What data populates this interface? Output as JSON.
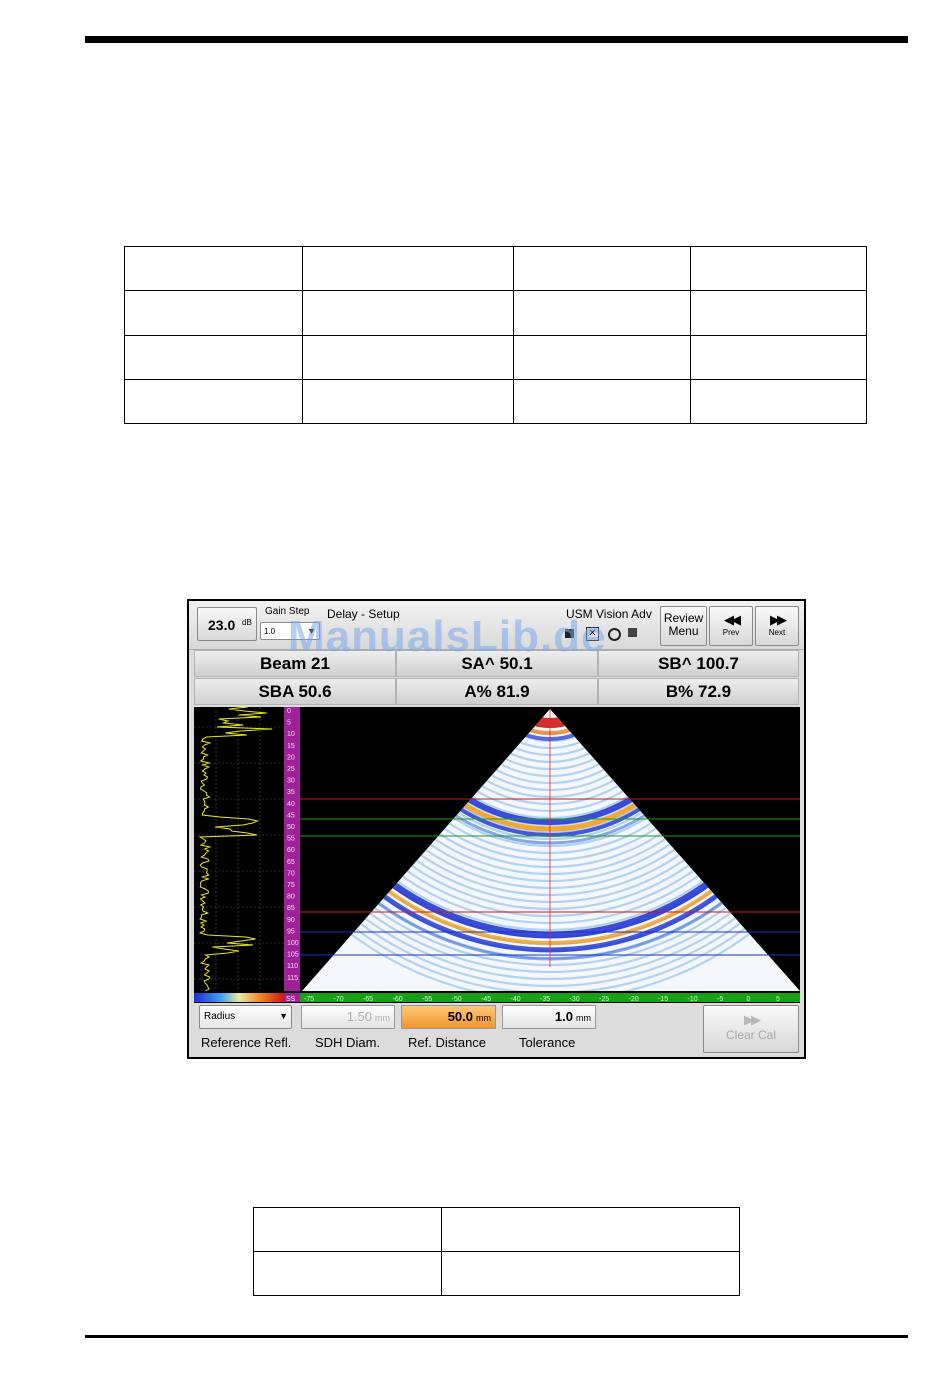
{
  "top_table": {
    "rows": 4,
    "cols": 4
  },
  "bottom_table": {
    "rows": 2,
    "cols": 2
  },
  "device": {
    "gain_value": "23.0",
    "gain_unit": "dB",
    "gain_step_label": "Gain Step",
    "gain_step_value": "1.0",
    "menu_title": "Delay - Setup",
    "app_title": "USM Vision Adv",
    "review_menu_line1": "Review",
    "review_menu_line2": "Menu",
    "prev_label": "Prev",
    "next_label": "Next",
    "readouts": {
      "beam": "Beam 21",
      "sa": "SA^ 50.1",
      "sb": "SB^ 100.7",
      "sba": "SBA 50.6",
      "a_pct": "A% 81.9",
      "b_pct": "B% 72.9"
    },
    "depth_scale": [
      "0",
      "5",
      "10",
      "15",
      "20",
      "25",
      "30",
      "35",
      "40",
      "45",
      "50",
      "55",
      "60",
      "65",
      "70",
      "75",
      "80",
      "85",
      "90",
      "95",
      "100",
      "105",
      "110",
      "115"
    ],
    "depth_scale_end": "SS",
    "angle_scale": [
      "-75",
      "-70",
      "-65",
      "-60",
      "-55",
      "-50",
      "-45",
      "-40",
      "-35",
      "-30",
      "-25",
      "-20",
      "-15",
      "-10",
      "-5",
      "0",
      "5"
    ],
    "reference_refl_value": "Radius",
    "reference_refl_label": "Reference Refl.",
    "sdh_diam_value": "1.50",
    "sdh_diam_unit": "mm",
    "sdh_diam_label": "SDH Diam.",
    "ref_distance_value": "50.0",
    "ref_distance_unit": "mm",
    "ref_distance_label": "Ref. Distance",
    "tolerance_value": "1.0",
    "tolerance_unit": "mm",
    "tolerance_label": "Tolerance",
    "clear_cal_label": "Clear Cal"
  },
  "watermark": "ManualsLib.de",
  "colors": {
    "gate_red": "#d01818",
    "gate_green": "#1aa01a",
    "gate_blue": "#1a2fd0",
    "active_field": "#f5a53a",
    "depth_bar": "#a0209a",
    "angle_bar": "#19a019"
  }
}
